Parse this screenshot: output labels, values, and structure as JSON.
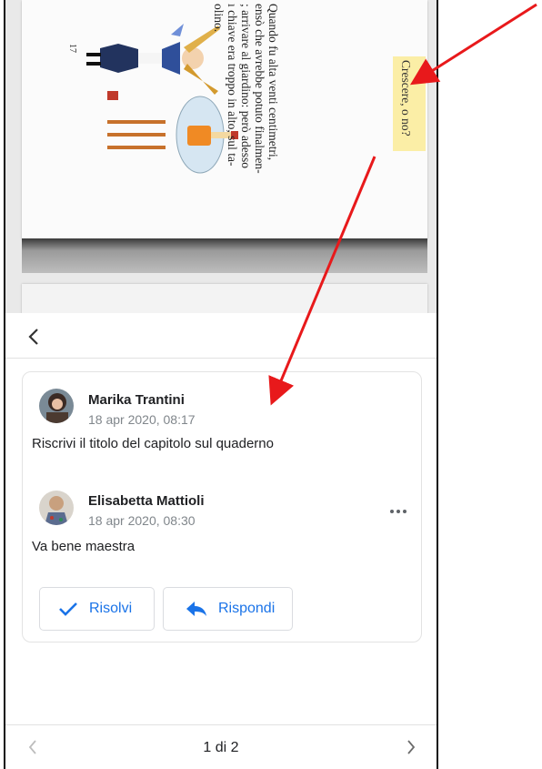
{
  "document": {
    "text_lines": [
      "Quando fu alta venti centimetri,",
      "ensò che avrebbe potuto finalmen-",
      "; arrivare al giardino: però adesso",
      "ı chiave era troppo in alto, sul ta-",
      "olino."
    ],
    "page_number": "17",
    "highlighted_title": "Crescere, o no?"
  },
  "comment_panel": {
    "comments": [
      {
        "author": "Marika Trantini",
        "date": "18 apr 2020, 08:17",
        "text": "Riscrivi il titolo del capitolo sul quaderno"
      },
      {
        "author": "Elisabetta Mattioli",
        "date": "18 apr 2020, 08:30",
        "text": "Va bene maestra"
      }
    ],
    "resolve_label": "Risolvi",
    "reply_label": "Rispondi"
  },
  "pager": {
    "text": "1 di 2"
  },
  "colors": {
    "accent": "#1a73e8",
    "highlight": "#fbeea6",
    "annotation_arrow": "#e8191b"
  },
  "icons": [
    "chevron-left-icon",
    "more-horizontal-icon",
    "check-icon",
    "reply-arrow-icon",
    "chevron-right-icon"
  ]
}
